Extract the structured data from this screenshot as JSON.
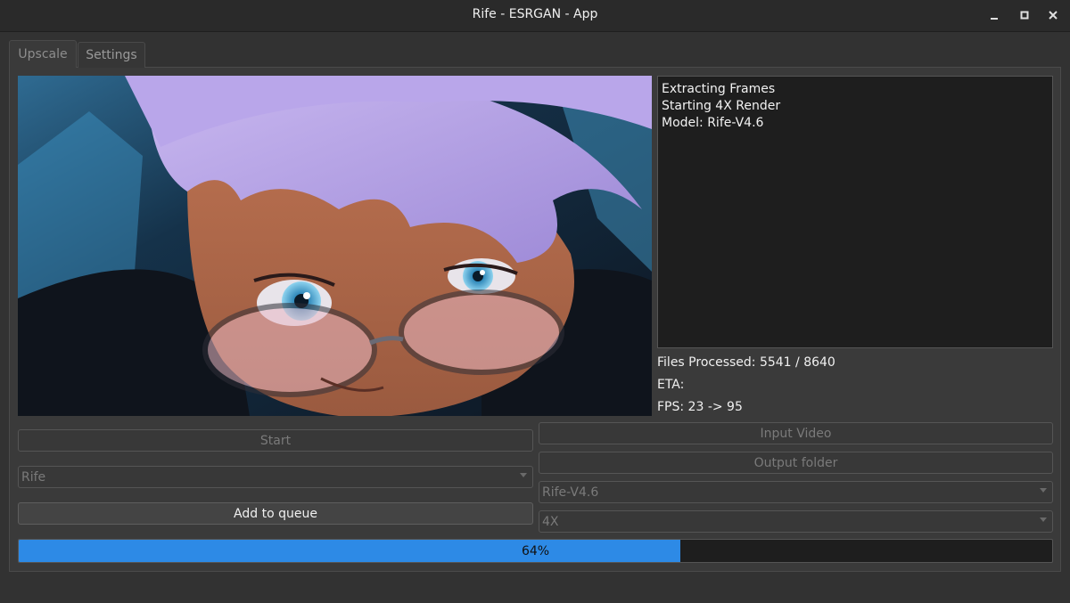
{
  "window": {
    "title": "Rife - ESRGAN - App"
  },
  "tabs": [
    {
      "label": "Upscale",
      "active": true
    },
    {
      "label": "Settings",
      "active": false
    }
  ],
  "log": {
    "lines": [
      "Extracting Frames",
      "Starting 4X Render",
      "Model: Rife-V4.6"
    ]
  },
  "status": {
    "files_processed": "Files Processed: 5541 / 8640",
    "eta": "ETA:",
    "fps": "FPS: 23 -> 95"
  },
  "controls": {
    "start_label": "Start",
    "input_video_label": "Input Video",
    "output_folder_label": "Output folder",
    "add_to_queue_label": "Add to queue",
    "interpolator_select": "Rife",
    "model_select": "Rife-V4.6",
    "multiplier_select": "4X"
  },
  "progress": {
    "value": 0.64,
    "label": "64%"
  },
  "colors": {
    "accent": "#2d8ae6",
    "background": "#3a3a3a",
    "log_background": "#1e1e1e"
  }
}
